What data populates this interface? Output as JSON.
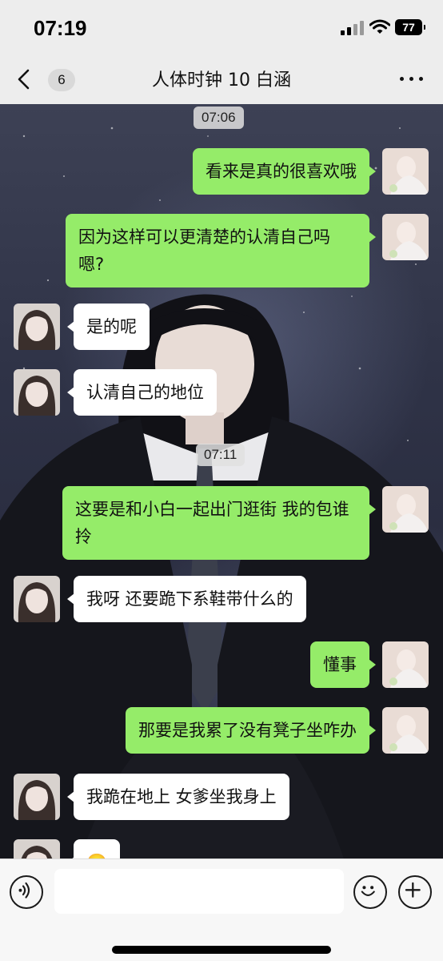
{
  "status_bar": {
    "time": "07:19",
    "battery": "77",
    "icons": [
      "signal-icon",
      "wifi-icon",
      "battery-icon"
    ]
  },
  "nav": {
    "back_badge": "6",
    "title": "人体时钟 10 白涵",
    "icons": [
      "chevron-left-icon",
      "more-icon"
    ]
  },
  "chat": {
    "timestamps": [
      "07:06",
      "07:11"
    ],
    "messages": [
      {
        "from": "me",
        "text": "看来是真的很喜欢哦"
      },
      {
        "from": "me",
        "text": "因为这样可以更清楚的认清自己吗 嗯?"
      },
      {
        "from": "them",
        "text": "是的呢"
      },
      {
        "from": "them",
        "text": "认清自己的地位"
      },
      {
        "from": "me",
        "text": "这要是和小白一起出门逛街 我的包谁拎"
      },
      {
        "from": "them",
        "text": "我呀 还要跪下系鞋带什么的"
      },
      {
        "from": "me",
        "text": "懂事"
      },
      {
        "from": "me",
        "text": "那要是我累了没有凳子坐咋办"
      },
      {
        "from": "them",
        "text": "我跪在地上 女爹坐我身上"
      },
      {
        "from": "them",
        "text": "🙂"
      }
    ]
  },
  "input_bar": {
    "value": "",
    "placeholder": "",
    "icons": [
      "voice-icon",
      "emoji-icon",
      "plus-icon"
    ]
  },
  "colors": {
    "my_bubble": "#95ec69",
    "their_bubble": "#ffffff",
    "bar_background": "#ededed"
  }
}
